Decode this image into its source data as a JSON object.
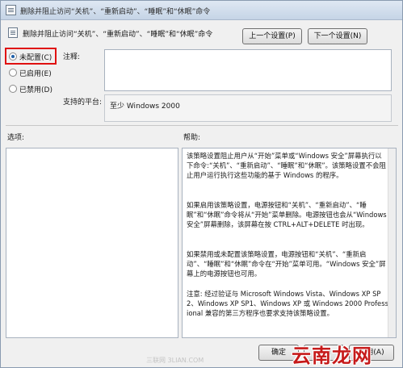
{
  "window": {
    "title": "删除并阻止访问“关机”、“重新启动”、“睡眠”和“休眠”命令"
  },
  "header": {
    "policy_name": "删除并阻止访问“关机”、“重新启动”、“睡眠”和“休眠”命令",
    "prev_label": "上一个设置(P)",
    "next_label": "下一个设置(N)"
  },
  "state": {
    "options": [
      {
        "label": "未配置(C)",
        "checked": true
      },
      {
        "label": "已启用(E)",
        "checked": false
      },
      {
        "label": "已禁用(D)",
        "checked": false
      }
    ]
  },
  "comment": {
    "label": "注释:",
    "value": ""
  },
  "platform": {
    "label": "支持的平台:",
    "value": "至少 Windows 2000"
  },
  "sections": {
    "options_label": "选项:",
    "help_label": "帮助:"
  },
  "help": {
    "paragraphs": [
      "该策略设置阻止用户从“开始”菜单或“Windows 安全”屏幕执行以下命令:“关机”、“重新启动”、“睡眠”和“休眠”。该策略设置不会阻止用户运行执行这些功能的基于 Windows 的程序。",
      "如果启用该策略设置，电源按钮和“关机”、“重新启动”、“睡眠”和“休眠”命令将从“开始”菜单删除。电源按钮也会从“Windows 安全”屏幕删除，该屏幕在按 CTRL+ALT+DELETE 时出现。",
      "如果禁用或未配置该策略设置，电源按钮和“关机”、“重新启动”、“睡眠”和“休眠”命令在“开始”菜单可用。“Windows 安全”屏幕上的电源按钮也可用。",
      "注意: 经过验证与 Microsoft Windows Vista、Windows XP SP2、Windows XP SP1、Windows XP 或 Windows 2000 Professional 兼容的第三方程序也要求支持该策略设置。"
    ]
  },
  "footer": {
    "ok_label": "确定",
    "cancel_label": "取消",
    "apply_label": "应用(A)"
  },
  "watermark": {
    "small": "三联网 3LIAN.COM",
    "big": "云南龙网"
  },
  "colors": {
    "highlight_frame": "#e01010",
    "watermark_red": "#c61a1a"
  }
}
